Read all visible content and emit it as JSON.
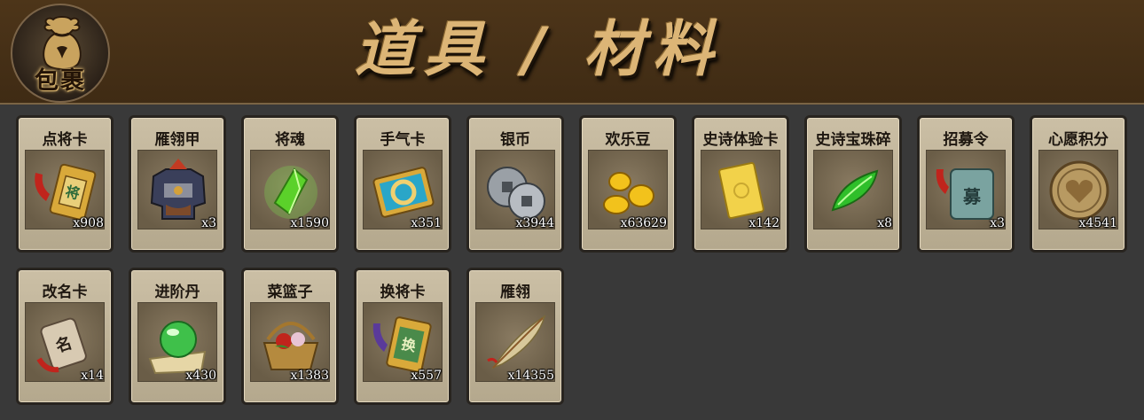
{
  "header": {
    "bag_label": "包裹",
    "title": "道具 / 材料"
  },
  "items": [
    {
      "name": "点将卡",
      "count": "x908",
      "icon": "general-card-icon"
    },
    {
      "name": "雁翎甲",
      "count": "x3",
      "icon": "armor-icon"
    },
    {
      "name": "将魂",
      "count": "x1590",
      "icon": "green-crystal-icon"
    },
    {
      "name": "手气卡",
      "count": "x351",
      "icon": "luck-card-icon"
    },
    {
      "name": "银币",
      "count": "x3944",
      "icon": "silver-coin-icon"
    },
    {
      "name": "欢乐豆",
      "count": "x63629",
      "icon": "gold-bean-icon"
    },
    {
      "name": "史诗体验卡",
      "count": "x142",
      "icon": "gold-card-icon"
    },
    {
      "name": "史诗宝珠碎",
      "count": "x8",
      "icon": "jade-shard-icon"
    },
    {
      "name": "招募令",
      "count": "x3",
      "icon": "recruit-token-icon"
    },
    {
      "name": "心愿积分",
      "count": "x4541",
      "icon": "heart-coin-icon"
    },
    {
      "name": "改名卡",
      "count": "x14",
      "icon": "rename-card-icon"
    },
    {
      "name": "进阶丹",
      "count": "x430",
      "icon": "green-pill-icon"
    },
    {
      "name": "菜篮子",
      "count": "x1383",
      "icon": "basket-icon"
    },
    {
      "name": "换将卡",
      "count": "x557",
      "icon": "swap-card-icon"
    },
    {
      "name": "雁翎",
      "count": "x14355",
      "icon": "feather-icon"
    }
  ]
}
